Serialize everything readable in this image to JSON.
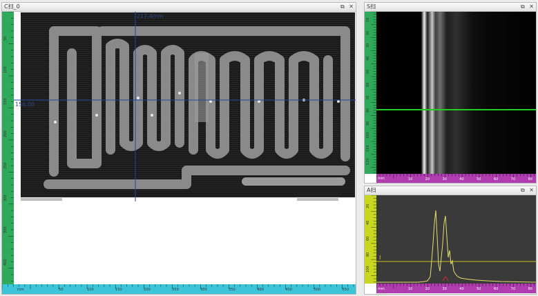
{
  "panels": {
    "c": {
      "title": "C扫_0",
      "restore_icon": "restore-icon",
      "close_icon": "close-icon"
    },
    "s": {
      "title": "S扫",
      "restore_icon": "restore-icon",
      "close_icon": "close-icon"
    },
    "a": {
      "title": "A扫",
      "restore_icon": "restore-icon",
      "close_icon": "close-icon"
    }
  },
  "controls": {
    "restore_glyph": "⧉",
    "close_glyph": "✕"
  },
  "c_scan": {
    "crosshair_x_label": "217.4mm",
    "crosshair_y_label": "156.00",
    "h_ruler_unit": "mm",
    "h_ticks": [
      "50",
      "100",
      "150",
      "200",
      "250",
      "300",
      "350",
      "400",
      "450",
      "500",
      "550"
    ],
    "v_ticks": [
      "50",
      "100",
      "150",
      "200",
      "250",
      "300",
      "350",
      "400"
    ]
  },
  "s_scan": {
    "h_ruler_unit": "mm",
    "h_ticks": [
      "10",
      "20",
      "30",
      "40",
      "50",
      "60",
      "70",
      "80"
    ],
    "v_ticks": [
      "10",
      "20",
      "30",
      "40",
      "50",
      "60",
      "70",
      "80",
      "90",
      "100",
      "110",
      "120"
    ]
  },
  "a_scan": {
    "h_ruler_unit": "mm",
    "h_ticks": [
      "10",
      "20",
      "30",
      "40",
      "50",
      "60",
      "70",
      "80"
    ],
    "v_ticks": [
      "20",
      "40",
      "60",
      "80",
      "100"
    ],
    "gate_label": "I",
    "gate_level_percent": 25
  },
  "colors": {
    "green_ruler": "#2eaa5a",
    "cyan_ruler": "#3cc4d8",
    "purple_ruler": "#b03cb0",
    "yellow_ruler": "#c8d820",
    "crosshair": "#2048a0",
    "s_cursor": "#22cc22",
    "a_trace": "#e8e070"
  }
}
